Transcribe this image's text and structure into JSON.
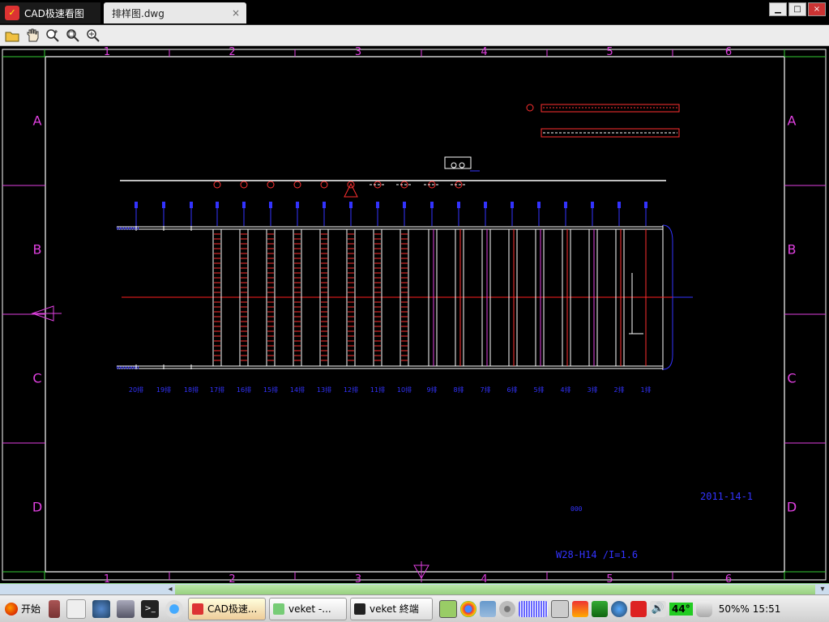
{
  "window": {
    "app_title": "CAD极速看图",
    "file_tab": "排样图.dwg",
    "tab_close": "×",
    "buttons": {
      "minimize": "▁",
      "maximize": "□",
      "close": "×"
    }
  },
  "toolbar": {
    "items": [
      "open-folder-icon",
      "pan-hand-icon",
      "zoom-in-icon",
      "zoom-window-icon",
      "zoom-extents-icon"
    ]
  },
  "drawing": {
    "col_numbers": [
      "1",
      "2",
      "3",
      "4",
      "5",
      "6"
    ],
    "row_letters": [
      "A",
      "B",
      "C",
      "D"
    ],
    "bay_labels": [
      "20排",
      "19排",
      "18排",
      "17排",
      "16排",
      "15排",
      "14排",
      "13排",
      "12排",
      "11排",
      "10排",
      "9排",
      "8排",
      "7排",
      "6排",
      "5排",
      "4排",
      "3排",
      "2排",
      "1排"
    ],
    "date_text": "2011-14-1",
    "mid_note": "000",
    "spec_text": "W28-H14 /I=1.6"
  },
  "colors": {
    "border": "#ffffff",
    "zone": "#e040e0",
    "blue": "#3333ff",
    "red": "#ff2020",
    "green": "#33cc33"
  },
  "taskbar": {
    "start_label": "开始",
    "tasks": [
      {
        "label": "CAD极速..."
      },
      {
        "label": "veket -..."
      },
      {
        "label": "veket 終端"
      }
    ],
    "temperature": "44°",
    "battery": "50%%",
    "clock": "15:51"
  }
}
